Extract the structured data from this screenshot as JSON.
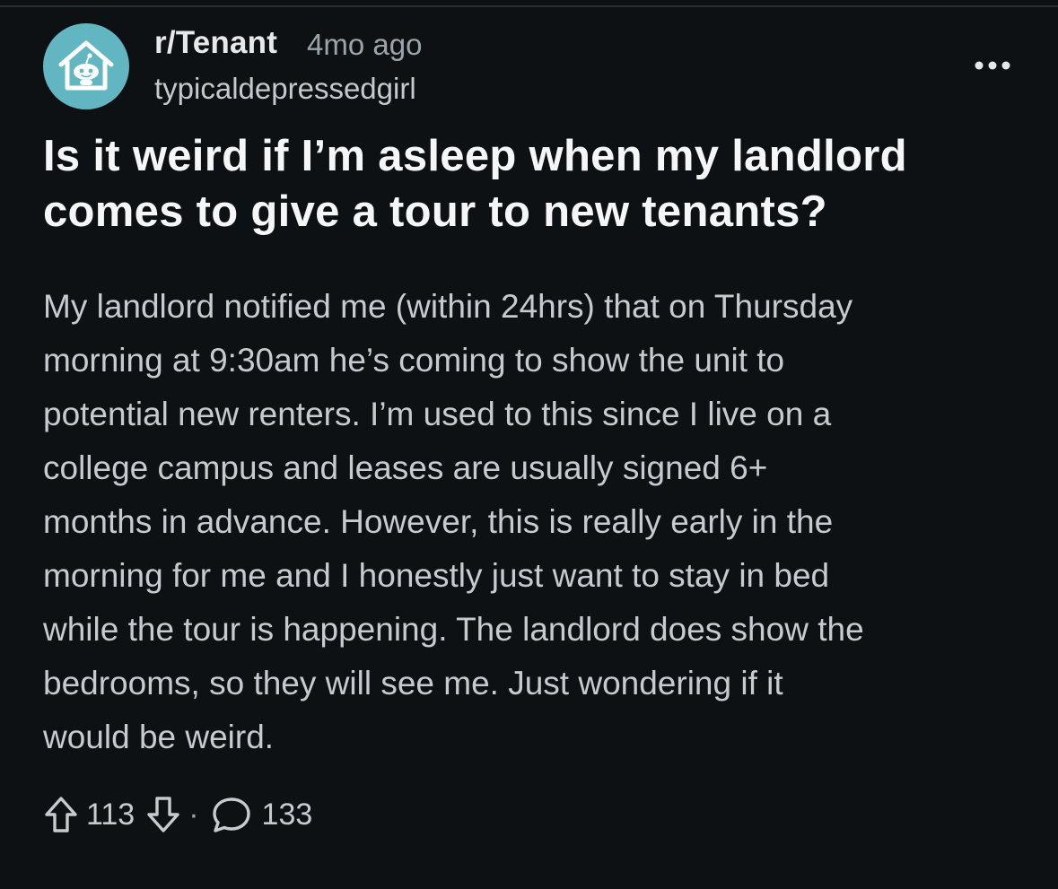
{
  "colors": {
    "background": "#0e1113",
    "avatar_bg": "#62b6c2",
    "title_text": "#f4f6f7",
    "body_text": "#c5cbce",
    "meta_text": "#9aa4a9"
  },
  "post": {
    "subreddit": "r/Tenant",
    "age": "4mo ago",
    "username": "typicaldepressedgirl",
    "avatar_icon": "house-robot-icon",
    "more_icon": "more-options-icon",
    "title": "Is it weird if I’m asleep when my landlord comes to give a tour to new tenants?",
    "body": "My landlord notified me (within 24hrs) that on Thursday\nmorning at 9:30am he’s coming to show the unit to\npotential new renters. I’m used to this since I live on a\ncollege campus and leases are usually signed 6+\nmonths in advance. However, this is really early in the\nmorning for me and I honestly just want to stay in bed\nwhile the tour is happening. The landlord does show the\nbedrooms, so they will see me. Just wondering if it\nwould be weird."
  },
  "actions": {
    "upvote_icon": "upvote-arrow-icon",
    "score": "113",
    "downvote_icon": "downvote-arrow-icon",
    "separator": "·",
    "comment_icon": "comment-bubble-icon",
    "comments": "133"
  }
}
